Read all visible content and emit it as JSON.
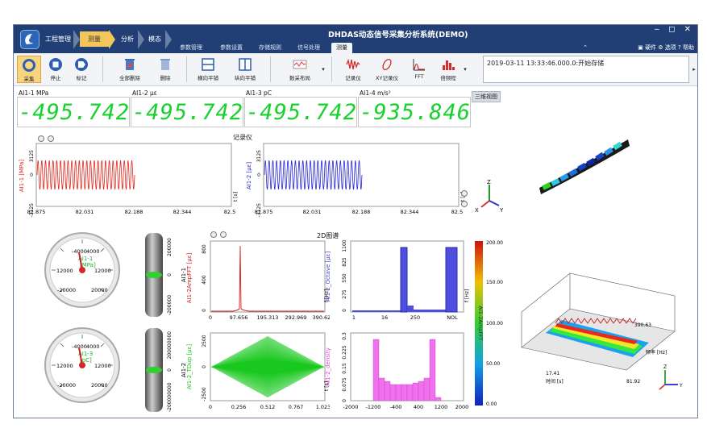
{
  "app": {
    "title": "DHDAS动态信号采集分析系统(DEMO)",
    "window_controls": "‒ ◻ ✕"
  },
  "breadcrumbs": [
    "工程管理",
    "测量",
    "分析",
    "模态"
  ],
  "ribbon_tabs": [
    "参数管理",
    "参数设置",
    "存储规则",
    "信号处理",
    "测量"
  ],
  "right_menu": {
    "hardware": "硬件",
    "options": "选项",
    "help": "帮助"
  },
  "ribbon_buttons": {
    "collect": "采集",
    "stop": "停止",
    "mark": "标记",
    "delete_all": "全部删除",
    "delete": "删除",
    "h_tile": "横向平铺",
    "v_tile": "纵向平铺",
    "layout": "数采布局",
    "recorder": "记录仪",
    "xy_recorder": "XY记录仪",
    "fft": "FFT",
    "histogram": "倍频程"
  },
  "log": {
    "text": "2019-03-11 13:33:46.000.0:开始存储"
  },
  "meters": [
    {
      "label": "AI1-1  MPa",
      "value": "-495.742"
    },
    {
      "label": "AI1-2  με",
      "value": "-495.742"
    },
    {
      "label": "AI1-3  pC",
      "value": "-495.742"
    },
    {
      "label": "AI1-4  m/s²",
      "value": "-935.846"
    }
  ],
  "view3d_label": "三维视图",
  "recorder": {
    "title": "记录仪",
    "left": {
      "ylabel": "AI1-1 [MPa]",
      "yticks": [
        "3125",
        "0",
        "-3125"
      ],
      "xticks": [
        "81.875",
        "82.031",
        "82.188",
        "82.344",
        "82.5"
      ],
      "xunit": "t [s]",
      "color": "#e2261d"
    },
    "right": {
      "ylabel": "AI1-2 [με]",
      "yticks": [
        "3125",
        "0",
        "-3125"
      ],
      "xticks": [
        "81.875",
        "82.031",
        "82.188",
        "82.344",
        "82.5"
      ],
      "xunit": "t [s]",
      "color": "#2424d6"
    }
  },
  "gauges": [
    {
      "name": "AI1-1",
      "unit": "[MPa]",
      "ticks": [
        "-4000",
        "4000",
        "12000",
        "12000",
        "-20000",
        "20000"
      ]
    },
    {
      "name": "AI1-3",
      "unit": "[pC]",
      "ticks": [
        "-4000",
        "4000",
        "12000",
        "12000",
        "-20000",
        "20000"
      ]
    }
  ],
  "bars": [
    {
      "label": "AI1-1",
      "ticks": [
        "200000",
        "0",
        "-200000"
      ]
    },
    {
      "label": "AI1-2",
      "ticks": [
        "200000000",
        "0",
        "-200000000"
      ]
    }
  ],
  "spectrum_title": "2D图谱",
  "fft_chart": {
    "ylabel": "AI1-2AmpFFT [με]",
    "yticks": [
      "800",
      "400",
      "0"
    ],
    "xticks": [
      "0",
      "97.656",
      "195.313",
      "292.969",
      "390.625"
    ],
    "xunit": "f [Hz]",
    "color": "#d31c1c"
  },
  "octave_chart": {
    "ylabel": "AI1-2_Octave [με]",
    "yticks": [
      "1100",
      "825",
      "550",
      "275",
      "0"
    ],
    "xticks": [
      "1",
      "16",
      "250",
      "NOL"
    ],
    "xunit": "f [Hz]",
    "color": "#3f3fd6"
  },
  "td_chart": {
    "ylabel": "AI1-2_TDup [με]",
    "yticks": [
      "2500",
      "0",
      "-2500"
    ],
    "xticks": [
      "0",
      "0.256",
      "0.512",
      "0.767",
      "1.023"
    ],
    "xunit": "t [s]",
    "color": "#19c81e"
  },
  "density_chart": {
    "ylabel": "AI1-2_density",
    "yticks": [
      "0.3",
      "0.225",
      "0.15",
      "0.075",
      "0"
    ],
    "xticks": [
      "-2000",
      "-1200",
      "-400",
      "400",
      "1200",
      "2000"
    ],
    "color": "#e83ee0"
  },
  "colorbar": {
    "label": "AI1-2AmpFFT",
    "ticks": [
      "200.00",
      "150.00",
      "100.00",
      "50.00",
      "0.00"
    ]
  },
  "waterfall": {
    "freq_max": "390.63",
    "freq_label": "频率 [Hz]",
    "freq_min": "0",
    "time_start": "17.41",
    "time_end": "81.92",
    "time_label": "时间 [s]"
  },
  "axes3d": {
    "x": "X",
    "y": "Y",
    "z": "Z"
  }
}
